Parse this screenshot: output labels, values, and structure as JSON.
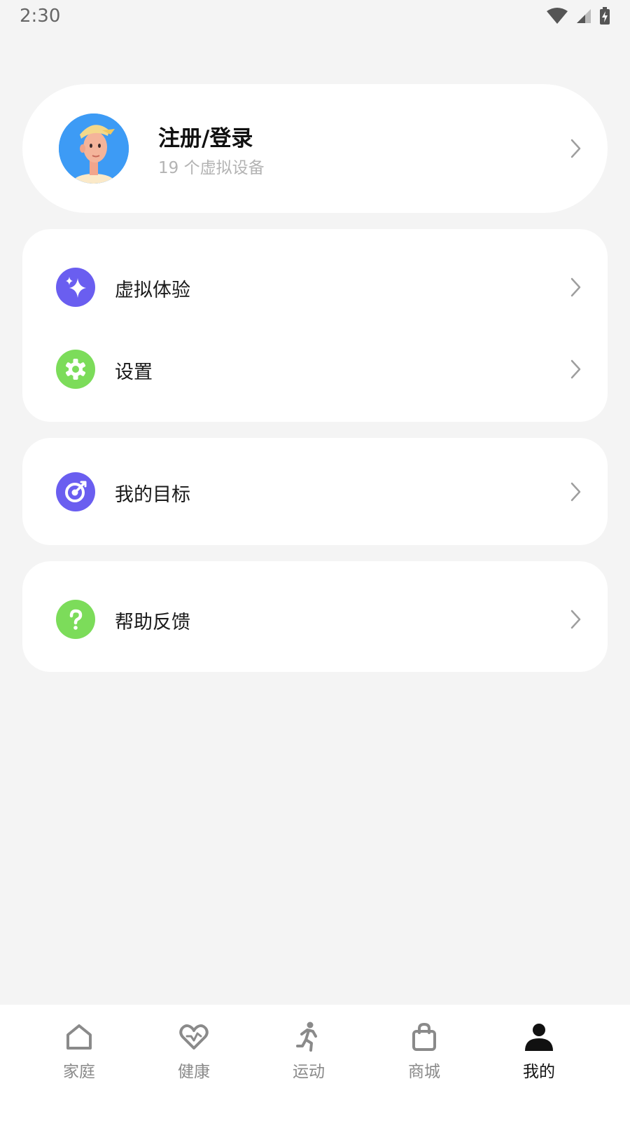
{
  "status_bar": {
    "time": "2:30"
  },
  "profile": {
    "name": "注册/登录",
    "subtitle": "19 个虚拟设备"
  },
  "menu": {
    "group1": [
      {
        "label": "虚拟体验",
        "icon": "sparkle-icon",
        "color": "#6a5ef0"
      },
      {
        "label": "设置",
        "icon": "gear-icon",
        "color": "#7cdc5a"
      }
    ],
    "group2": [
      {
        "label": "我的目标",
        "icon": "target-icon",
        "color": "#6a5ef0"
      }
    ],
    "group3": [
      {
        "label": "帮助反馈",
        "icon": "help-icon",
        "color": "#7cdc5a"
      }
    ]
  },
  "bottom_nav": {
    "items": [
      {
        "label": "家庭",
        "icon": "home-icon",
        "active": false
      },
      {
        "label": "健康",
        "icon": "heart-icon",
        "active": false
      },
      {
        "label": "运动",
        "icon": "running-icon",
        "active": false
      },
      {
        "label": "商城",
        "icon": "shopping-bag-icon",
        "active": false
      },
      {
        "label": "我的",
        "icon": "person-icon",
        "active": true
      }
    ]
  },
  "colors": {
    "background": "#f4f4f4",
    "card": "#ffffff",
    "purple_accent": "#6a5ef0",
    "green_accent": "#7cdc5a",
    "avatar_bg": "#3d9bf5"
  }
}
